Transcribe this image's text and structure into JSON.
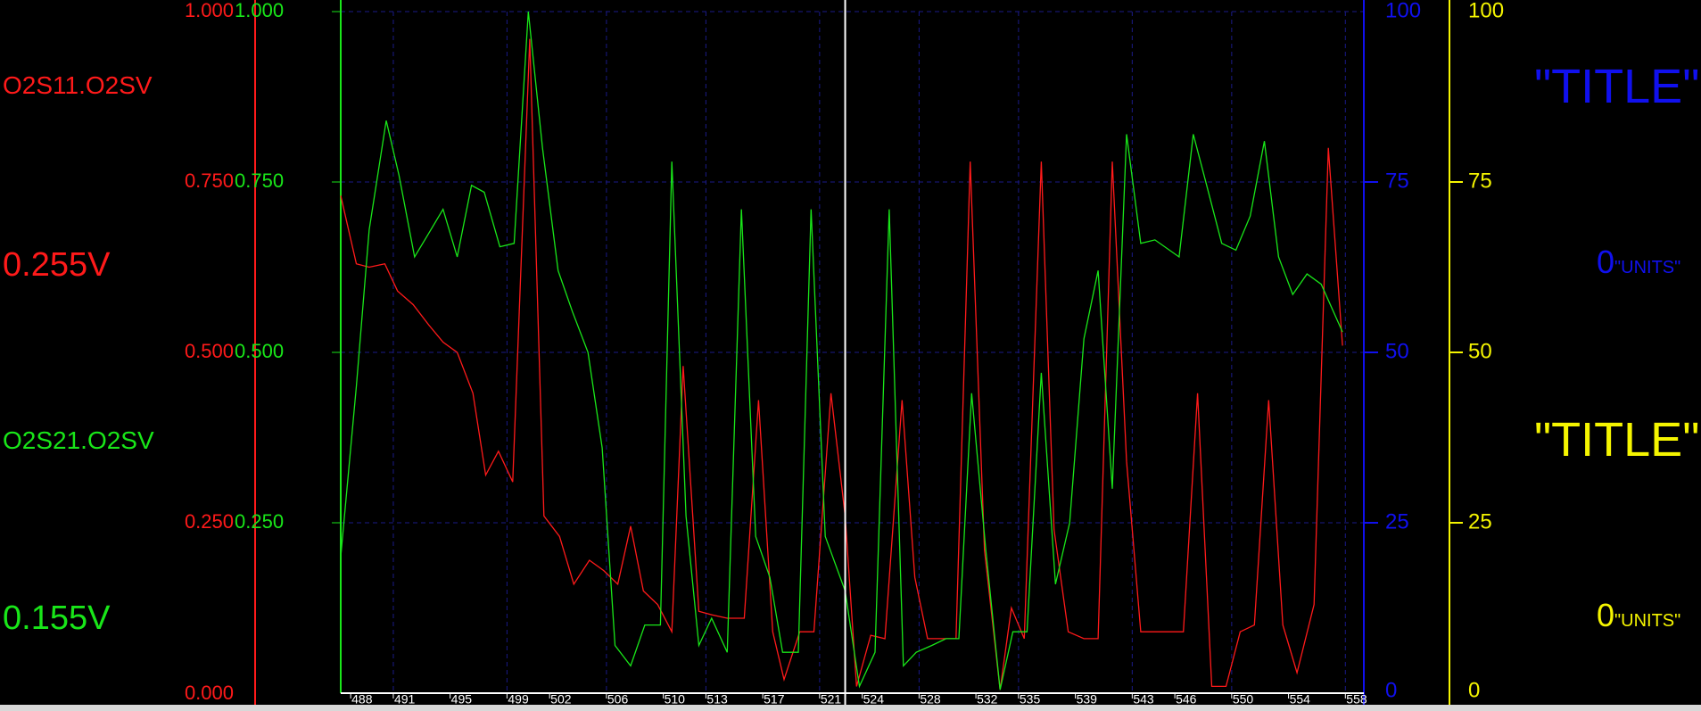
{
  "colors": {
    "ch1": "#ff1a1a",
    "ch2": "#19e619",
    "ch3": "#1010ee",
    "ch4": "#f5f500",
    "grid": "#1a1a88",
    "cursor": "#ffffff"
  },
  "left_panel": {
    "ch1_name": "O2S11.O2SV",
    "ch1_value": "0.255V",
    "ch2_name": "O2S21.O2SV",
    "ch2_value": "0.155V"
  },
  "right_panel": {
    "ch3_title": "\"TITLE\"",
    "ch3_value": "0",
    "ch3_units": "\"UNITS\"",
    "ch4_title": "\"TITLE\"",
    "ch4_value": "0",
    "ch4_units": "\"UNITS\""
  },
  "chart_data": {
    "type": "line",
    "x_ticks": [
      "488",
      "491",
      "495",
      "499",
      "502",
      "506",
      "510",
      "513",
      "517",
      "521",
      "524",
      "528",
      "532",
      "535",
      "539",
      "543",
      "546",
      "550",
      "554",
      "558"
    ],
    "x_range": [
      487.3,
      559.3
    ],
    "cursor_x": 522.8,
    "axes": {
      "ch1": {
        "ticks": [
          "1.000",
          "0.750",
          "0.500",
          "0.250",
          "0.000"
        ],
        "range": [
          0,
          1
        ]
      },
      "ch2": {
        "ticks": [
          "1.000",
          "0.750",
          "0.500",
          "0.250"
        ],
        "range": [
          0,
          1
        ]
      },
      "ch3": {
        "ticks": [
          "100",
          "75",
          "50",
          "25",
          "0"
        ],
        "range": [
          0,
          100
        ]
      },
      "ch4": {
        "ticks": [
          "100",
          "75",
          "50",
          "25",
          "0"
        ],
        "range": [
          0,
          100
        ]
      }
    },
    "grid": true,
    "series": [
      {
        "name": "O2S11.O2SV",
        "color": "#ff1a1a",
        "points": [
          [
            487.3,
            0.73
          ],
          [
            488.4,
            0.63
          ],
          [
            489.3,
            0.625
          ],
          [
            490.4,
            0.63
          ],
          [
            491.3,
            0.59
          ],
          [
            492.4,
            0.57
          ],
          [
            493.5,
            0.54
          ],
          [
            494.5,
            0.515
          ],
          [
            495.5,
            0.5
          ],
          [
            496.6,
            0.44
          ],
          [
            497.5,
            0.32
          ],
          [
            498.4,
            0.355
          ],
          [
            499.4,
            0.31
          ],
          [
            500.6,
            0.96
          ],
          [
            501.6,
            0.26
          ],
          [
            502.7,
            0.23
          ],
          [
            503.7,
            0.16
          ],
          [
            504.8,
            0.195
          ],
          [
            505.8,
            0.18
          ],
          [
            506.8,
            0.16
          ],
          [
            507.7,
            0.245
          ],
          [
            508.6,
            0.15
          ],
          [
            509.6,
            0.13
          ],
          [
            510.6,
            0.09
          ],
          [
            511.4,
            0.48
          ],
          [
            512.5,
            0.12
          ],
          [
            513.4,
            0.115
          ],
          [
            514.5,
            0.11
          ],
          [
            515.7,
            0.11
          ],
          [
            516.7,
            0.43
          ],
          [
            517.7,
            0.09
          ],
          [
            518.5,
            0.02
          ],
          [
            519.6,
            0.09
          ],
          [
            520.6,
            0.09
          ],
          [
            521.8,
            0.44
          ],
          [
            522.8,
            0.26
          ],
          [
            523.6,
            0.01
          ],
          [
            524.6,
            0.085
          ],
          [
            525.6,
            0.08
          ],
          [
            526.8,
            0.43
          ],
          [
            527.7,
            0.17
          ],
          [
            528.6,
            0.08
          ],
          [
            529.6,
            0.08
          ],
          [
            530.6,
            0.08
          ],
          [
            531.6,
            0.78
          ],
          [
            532.6,
            0.21
          ],
          [
            533.7,
            0.005
          ],
          [
            534.5,
            0.125
          ],
          [
            535.4,
            0.08
          ],
          [
            536.6,
            0.78
          ],
          [
            537.5,
            0.24
          ],
          [
            538.5,
            0.09
          ],
          [
            539.6,
            0.08
          ],
          [
            540.6,
            0.08
          ],
          [
            541.6,
            0.78
          ],
          [
            542.6,
            0.34
          ],
          [
            543.6,
            0.09
          ],
          [
            544.6,
            0.09
          ],
          [
            545.6,
            0.09
          ],
          [
            546.6,
            0.09
          ],
          [
            547.6,
            0.44
          ],
          [
            548.6,
            0.01
          ],
          [
            549.6,
            0.01
          ],
          [
            550.6,
            0.09
          ],
          [
            551.6,
            0.1
          ],
          [
            552.6,
            0.43
          ],
          [
            553.6,
            0.1
          ],
          [
            554.6,
            0.03
          ],
          [
            555.8,
            0.13
          ],
          [
            556.8,
            0.8
          ],
          [
            557.8,
            0.51
          ]
        ]
      },
      {
        "name": "O2S21.O2SV",
        "color": "#19e619",
        "points": [
          [
            487.3,
            0.2
          ],
          [
            488.4,
            0.45
          ],
          [
            489.3,
            0.68
          ],
          [
            490.5,
            0.84
          ],
          [
            491.4,
            0.76
          ],
          [
            492.5,
            0.64
          ],
          [
            493.5,
            0.675
          ],
          [
            494.5,
            0.71
          ],
          [
            495.5,
            0.64
          ],
          [
            496.5,
            0.745
          ],
          [
            497.4,
            0.735
          ],
          [
            498.5,
            0.655
          ],
          [
            499.5,
            0.66
          ],
          [
            500.5,
            1.0
          ],
          [
            501.5,
            0.8
          ],
          [
            502.6,
            0.62
          ],
          [
            503.6,
            0.56
          ],
          [
            504.7,
            0.5
          ],
          [
            505.7,
            0.36
          ],
          [
            506.6,
            0.07
          ],
          [
            507.7,
            0.04
          ],
          [
            508.7,
            0.1
          ],
          [
            509.8,
            0.1
          ],
          [
            510.6,
            0.78
          ],
          [
            511.6,
            0.26
          ],
          [
            512.5,
            0.07
          ],
          [
            513.4,
            0.11
          ],
          [
            514.5,
            0.06
          ],
          [
            515.5,
            0.71
          ],
          [
            516.5,
            0.23
          ],
          [
            517.5,
            0.17
          ],
          [
            518.4,
            0.06
          ],
          [
            519.5,
            0.06
          ],
          [
            520.4,
            0.71
          ],
          [
            521.4,
            0.23
          ],
          [
            522.8,
            0.15
          ],
          [
            523.8,
            0.01
          ],
          [
            524.9,
            0.06
          ],
          [
            525.9,
            0.71
          ],
          [
            526.9,
            0.04
          ],
          [
            527.8,
            0.06
          ],
          [
            528.9,
            0.07
          ],
          [
            529.9,
            0.08
          ],
          [
            530.8,
            0.08
          ],
          [
            531.7,
            0.44
          ],
          [
            532.7,
            0.21
          ],
          [
            533.7,
            0.005
          ],
          [
            534.6,
            0.09
          ],
          [
            535.6,
            0.09
          ],
          [
            536.6,
            0.47
          ],
          [
            537.6,
            0.16
          ],
          [
            538.6,
            0.25
          ],
          [
            539.6,
            0.52
          ],
          [
            540.6,
            0.62
          ],
          [
            541.6,
            0.3
          ],
          [
            542.6,
            0.82
          ],
          [
            543.6,
            0.66
          ],
          [
            544.6,
            0.665
          ],
          [
            546.3,
            0.64
          ],
          [
            547.3,
            0.82
          ],
          [
            548.3,
            0.74
          ],
          [
            549.3,
            0.66
          ],
          [
            550.3,
            0.65
          ],
          [
            551.3,
            0.7
          ],
          [
            552.3,
            0.81
          ],
          [
            553.3,
            0.64
          ],
          [
            554.3,
            0.585
          ],
          [
            555.3,
            0.615
          ],
          [
            556.3,
            0.6
          ],
          [
            557.8,
            0.53
          ]
        ]
      }
    ]
  }
}
